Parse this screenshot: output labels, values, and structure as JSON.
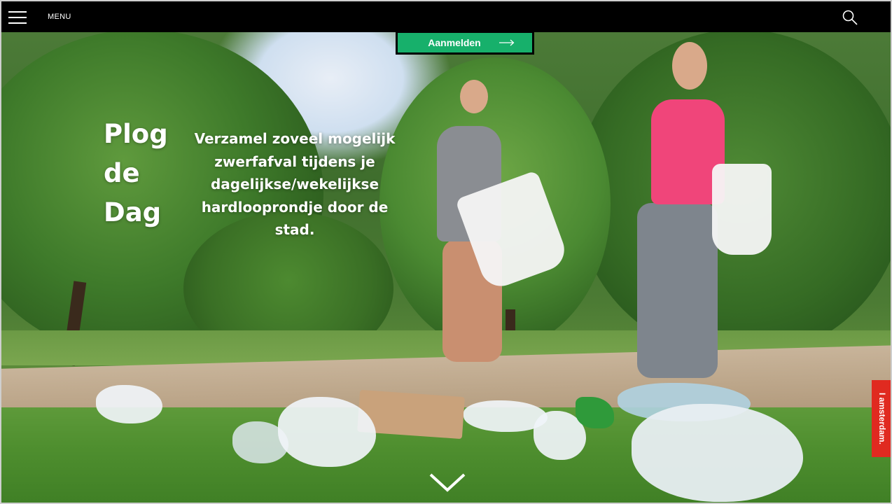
{
  "nav": {
    "menu_label": "MENU"
  },
  "hero": {
    "signup_label": "Aanmelden",
    "title": "Plog de Dag",
    "description": "Verzamel zoveel mogelijk zwerfafval tijdens je dagelijkse/wekelijkse hardlooprondje door de stad."
  },
  "side_tab": {
    "label": "I amsterdam."
  },
  "colors": {
    "topbar": "#000000",
    "signup_button": "#17b06b",
    "side_tab": "#e02a20",
    "text": "#ffffff"
  },
  "icons": {
    "menu": "hamburger-icon",
    "search": "search-icon",
    "signup_arrow": "arrow-right-icon",
    "scroll": "chevron-down-icon"
  }
}
